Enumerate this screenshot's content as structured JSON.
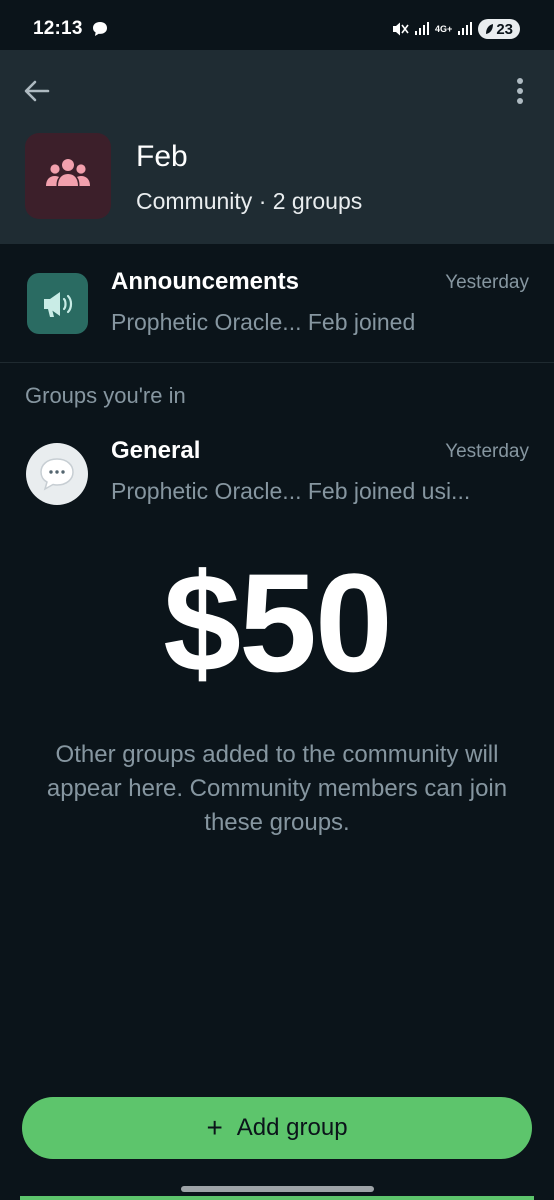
{
  "status_bar": {
    "time": "12:13",
    "network": "4G+",
    "battery": "23",
    "icons": [
      "chat-bubble-icon",
      "mute-icon",
      "signal-icon",
      "signal-icon",
      "battery-saver-icon"
    ]
  },
  "header": {
    "back_icon": "arrow-left-icon",
    "menu_icon": "more-vertical-icon",
    "community_name": "Feb",
    "community_subtitle": "Community · 2 groups",
    "avatar_icon": "community-people-icon",
    "avatar_color": "#3c1f2a",
    "avatar_icon_color": "#f2a0ad"
  },
  "announcements": {
    "title": "Announcements",
    "time": "Yesterday",
    "preview": "Prophetic Oracle... Feb joined",
    "icon": "megaphone-icon",
    "icon_bg": "#2a6b62"
  },
  "groups_section": {
    "label": "Groups you're in",
    "groups": [
      {
        "title": "General",
        "time": "Yesterday",
        "preview": "Prophetic Oracle... Feb joined usi...",
        "icon": "speech-bubble-icon"
      }
    ]
  },
  "overlay": {
    "price": "$50"
  },
  "info": {
    "text": "Other groups added to the community will appear here. Community members can join these groups."
  },
  "actions": {
    "add_group_label": "Add group",
    "add_group_icon": "plus-icon",
    "accent": "#5dc56c"
  }
}
